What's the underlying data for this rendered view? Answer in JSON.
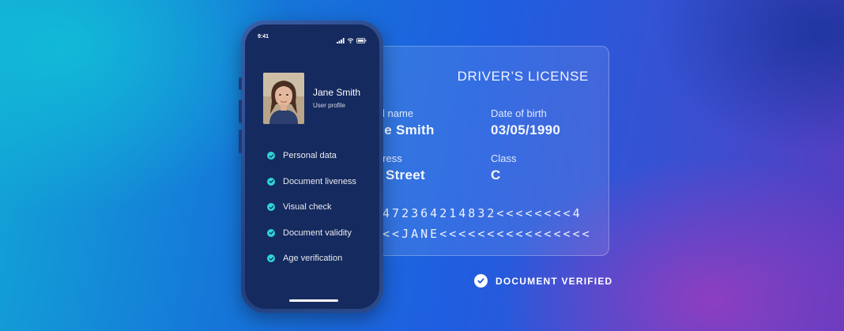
{
  "license": {
    "title": "DRIVER’S LICENSE",
    "fields": [
      {
        "label": "Full name",
        "value": "Jane Smith"
      },
      {
        "label": "Date of birth",
        "value": "03/05/1990"
      },
      {
        "label": "Address",
        "value": "Main Street"
      },
      {
        "label": "Class",
        "value": "C"
      }
    ],
    "mrz": [
      "0472364214832<<<<<<<<4",
      "<<<JANE<<<<<<<<<<<<<<<<"
    ]
  },
  "verified": {
    "text": "DOCUMENT VERIFIED",
    "icon": "check-circle-icon"
  },
  "phone": {
    "status": {
      "time": "9:41"
    },
    "profile": {
      "name": "Jane Smith",
      "subtitle": "User profile"
    },
    "checklist": [
      {
        "label": "Personal data"
      },
      {
        "label": "Document liveness"
      },
      {
        "label": "Visual check"
      },
      {
        "label": "Document validity"
      },
      {
        "label": "Age verification"
      }
    ]
  },
  "colors": {
    "check": "#2ed3d9",
    "screen": "#152a5e"
  }
}
